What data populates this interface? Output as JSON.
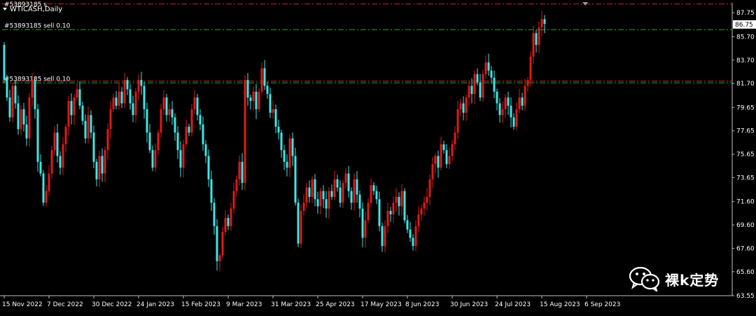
{
  "window": {
    "title": "WTICASH,Daily",
    "top_marker": "#53893185 s"
  },
  "watermark": {
    "text": "裸k定势",
    "icon": "wechat-icon"
  },
  "colors": {
    "background": "#000000",
    "bull": "#e11919",
    "bear": "#3ee6e6",
    "axis": "#c0c0c0",
    "order_line": "#2ea02e",
    "stop_line": "#cc2b2b"
  },
  "chart_data": {
    "type": "candlestick",
    "symbol": "WTICASH",
    "timeframe": "Daily",
    "ylim": [
      63.55,
      88.6
    ],
    "yticks": [
      "87.75",
      "85.70",
      "83.70",
      "81.70",
      "79.65",
      "77.65",
      "75.65",
      "73.65",
      "71.60",
      "69.60",
      "67.60",
      "65.60",
      "63.55"
    ],
    "current_price": "86.75",
    "xticks": [
      "15 Nov 2022",
      "7 Dec 2022",
      "30 Dec 2022",
      "24 Jan 2023",
      "15 Feb 2023",
      "9 Mar 2023",
      "31 Mar 2023",
      "25 Apr 2023",
      "17 May 2023",
      "8 Jun 2023",
      "30 Jun 2023",
      "24 Jul 2023",
      "15 Aug 2023",
      "6 Sep 2023"
    ],
    "xtick_index": [
      0,
      16,
      32,
      48,
      64,
      80,
      96,
      112,
      128,
      144,
      160,
      176,
      192,
      208
    ],
    "orders": [
      {
        "label": "#53893185 sell 0.10",
        "price": 86.3,
        "style": "order"
      },
      {
        "label": "#53893185 sell 0.10",
        "price": 81.75,
        "style": "order"
      },
      {
        "label": "",
        "price": 88.5,
        "style": "stop"
      },
      {
        "label": "",
        "price": 81.9,
        "style": "stop"
      }
    ],
    "start_close": 85.0,
    "closes": [
      82.0,
      80.5,
      78.8,
      81.5,
      80.0,
      77.8,
      79.5,
      78.2,
      77.0,
      80.5,
      82.0,
      79.5,
      75.0,
      74.0,
      71.5,
      72.5,
      74.0,
      76.0,
      77.5,
      75.5,
      74.5,
      76.5,
      78.0,
      80.2,
      79.0,
      80.5,
      81.2,
      79.8,
      78.5,
      77.0,
      79.0,
      77.5,
      75.0,
      73.5,
      75.5,
      74.0,
      76.0,
      77.8,
      79.5,
      80.5,
      79.8,
      81.0,
      80.0,
      82.0,
      81.2,
      80.0,
      79.0,
      81.0,
      82.0,
      81.5,
      79.5,
      77.5,
      76.0,
      74.5,
      76.0,
      77.5,
      79.5,
      80.5,
      79.0,
      79.5,
      78.8,
      77.5,
      76.0,
      74.5,
      76.5,
      78.0,
      77.5,
      79.5,
      80.5,
      79.0,
      78.2,
      76.5,
      75.5,
      73.5,
      71.5,
      69.5,
      66.5,
      67.0,
      69.0,
      70.2,
      69.5,
      71.0,
      72.5,
      73.5,
      75.0,
      73.2,
      82.0,
      80.5,
      80.2,
      81.0,
      79.5,
      81.0,
      83.0,
      81.5,
      80.8,
      79.2,
      79.5,
      78.0,
      77.5,
      76.0,
      75.0,
      74.5,
      77.0,
      75.5,
      71.5,
      68.0,
      70.8,
      71.5,
      72.8,
      72.0,
      73.5,
      71.8,
      71.2,
      72.5,
      71.8,
      71.0,
      72.5,
      72.0,
      73.5,
      72.8,
      71.5,
      73.2,
      74.0,
      72.5,
      71.5,
      73.5,
      72.2,
      71.0,
      68.5,
      70.0,
      71.5,
      73.0,
      72.5,
      71.8,
      69.5,
      67.8,
      69.5,
      70.8,
      70.5,
      71.5,
      72.0,
      71.2,
      72.5,
      70.0,
      69.2,
      68.5,
      67.8,
      69.5,
      70.5,
      71.0,
      71.5,
      72.0,
      73.5,
      74.8,
      75.5,
      74.5,
      76.5,
      76.0,
      74.8,
      75.5,
      76.5,
      77.5,
      79.5,
      80.0,
      79.2,
      80.5,
      81.5,
      80.8,
      82.5,
      81.8,
      80.5,
      82.5,
      83.5,
      82.8,
      82.2,
      81.0,
      80.0,
      79.0,
      79.5,
      80.5,
      79.8,
      78.8,
      78.0,
      79.5,
      80.5,
      79.8,
      81.5,
      82.0,
      84.0,
      86.0,
      85.0,
      86.5,
      87.2,
      86.8
    ]
  }
}
